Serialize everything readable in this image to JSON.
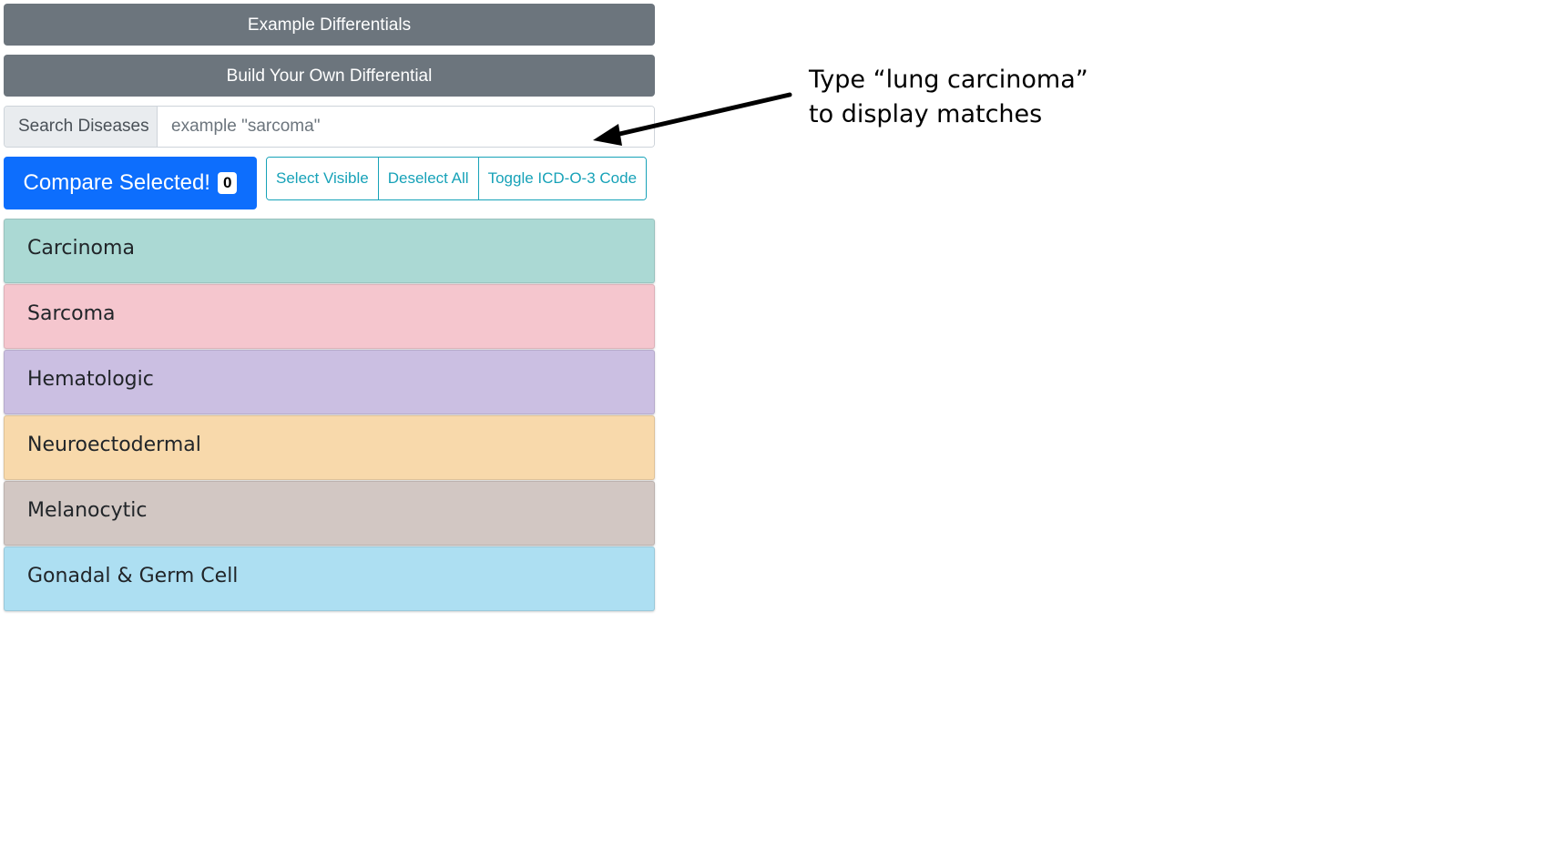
{
  "buttons": {
    "example_differentials": "Example Differentials",
    "build_differential": "Build Your Own Differential"
  },
  "search": {
    "label": "Search Diseases",
    "placeholder": "example \"sarcoma\"",
    "value": ""
  },
  "actions": {
    "compare_label": "Compare Selected!",
    "compare_count": "0",
    "select_visible": "Select Visible",
    "deselect_all": "Deselect All",
    "toggle_code": "Toggle ICD-O-3 Code"
  },
  "categories": [
    {
      "label": "Carcinoma",
      "color": "#abd9d4"
    },
    {
      "label": "Sarcoma",
      "color": "#f5c6ce"
    },
    {
      "label": "Hematologic",
      "color": "#cbbfe2"
    },
    {
      "label": "Neuroectodermal",
      "color": "#f8d9ab"
    },
    {
      "label": "Melanocytic",
      "color": "#d2c7c3"
    },
    {
      "label": "Gonadal & Germ Cell",
      "color": "#addff2"
    }
  ],
  "annotation": {
    "line1": "Type “lung carcinoma”",
    "line2": "to display matches"
  },
  "colors": {
    "gray_button": "#6c757d",
    "primary": "#0d6efd",
    "info": "#17a2b8"
  }
}
